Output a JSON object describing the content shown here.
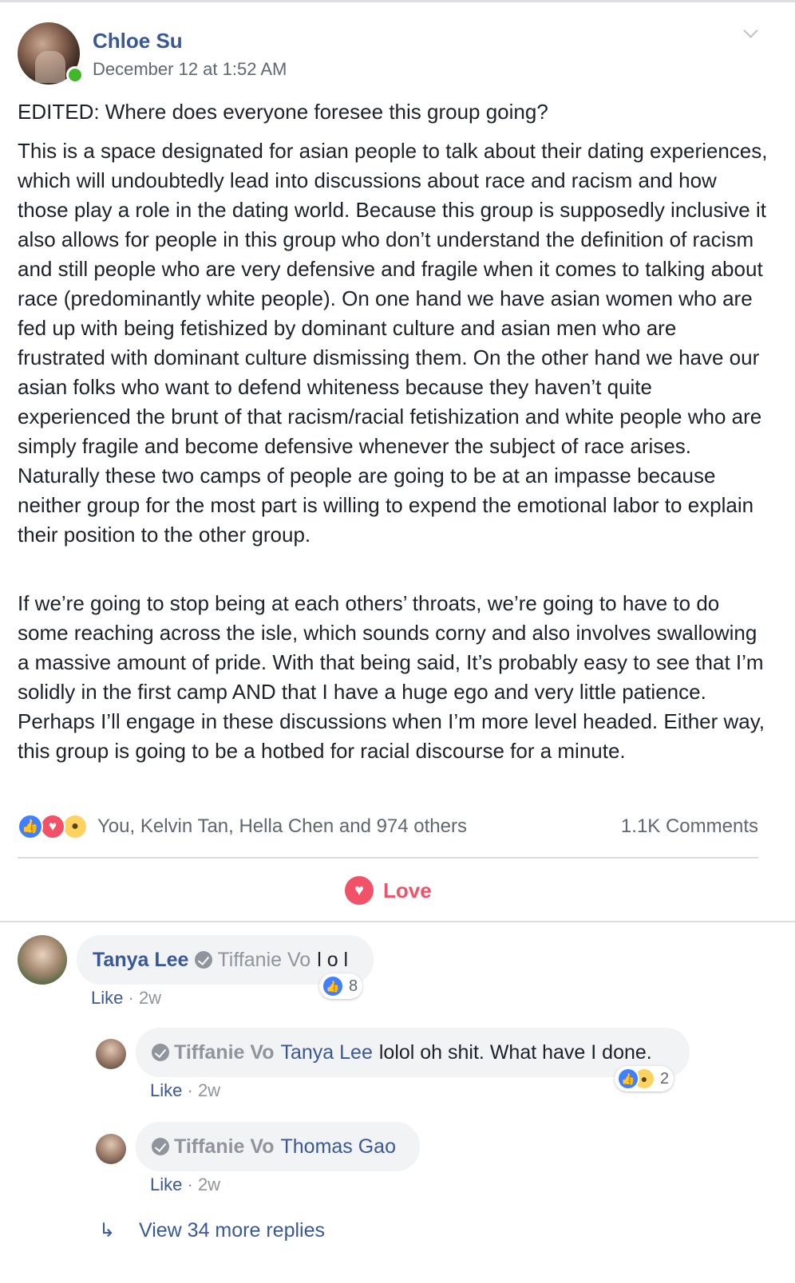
{
  "post": {
    "author": "Chloe Su",
    "timestamp": "December 12 at 1:52 AM",
    "paragraphs": [
      "EDITED: Where does everyone foresee this group going?",
      "This is a space designated for asian people to talk about their dating experiences, which will undoubtedly lead into discussions about race and racism and how those play a role in the dating world. Because this group is supposedly inclusive it also allows for people in this group who don’t understand the definition of racism and still people who are very defensive and fragile when it comes to talking about race (predominantly white people). On one hand we have asian women who are fed up with being fetishized by dominant culture and asian men who are frustrated with dominant culture dismissing them. On the other hand we have our asian folks who want to defend whiteness because they haven’t quite experienced the brunt of that racism/racial fetishization and white people who are simply fragile and become defensive whenever the subject of race arises. Naturally these two camps of people are going to be at an impasse because neither group for the most part is willing to expend the emotional labor to explain their position to the other group.",
      "If we’re going to stop being at each others’ throats, we’re going to have to do some reaching across the isle, which sounds corny and also involves swallowing a massive amount of pride. With that being said, It’s probably easy to see that I’m solidly in the first camp AND that I have a huge ego and very little patience. Perhaps I’ll engage in these discussions when I’m more level headed. Either way, this group is going to be a hotbed for racial discourse for a minute."
    ],
    "reactions_text": "You, Kelvin Tan, Hella Chen and 974 others",
    "comments_count": "1.1K Comments",
    "reaction_icons": [
      "like-icon",
      "love-icon",
      "wow-icon"
    ],
    "action_label": "Love"
  },
  "comments": [
    {
      "name": "Tanya Lee",
      "tag": "Tiffanie Vo",
      "text": "l o l",
      "like_label": "Like",
      "sep": "·",
      "age": "2w",
      "reaction_count": "8"
    },
    {
      "name": "Tiffanie Vo",
      "tag": "Tanya Lee",
      "text": "lolol oh shit. What have I done.",
      "like_label": "Like",
      "sep": "·",
      "age": "2w",
      "reaction_count": "2"
    },
    {
      "name": "Tiffanie Vo",
      "tag": "Thomas Gao",
      "text": "",
      "like_label": "Like",
      "sep": "·",
      "age": "2w"
    }
  ],
  "view_more": "View 34 more replies",
  "colors": {
    "link_blue": "#385898",
    "love_red": "#f25268",
    "like_blue": "#4080ff",
    "online_green": "#42b72a",
    "meta_grey": "#90949c"
  }
}
